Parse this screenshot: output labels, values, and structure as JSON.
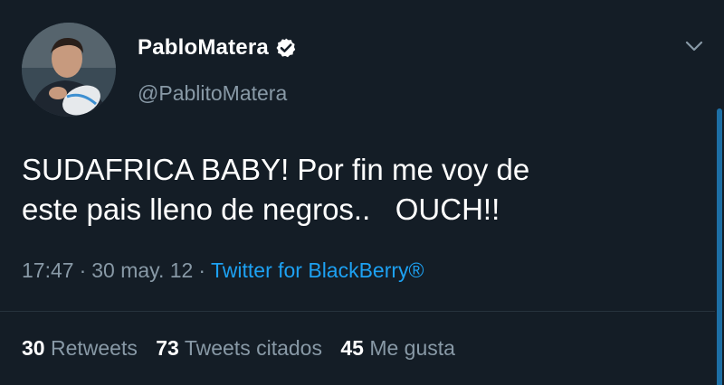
{
  "tweet": {
    "display_name": "PabloMatera",
    "handle": "@PablitoMatera",
    "verified_icon": "verified-badge-icon",
    "menu_icon": "chevron-down-icon",
    "text_lines": [
      "SUDAFRICA BABY! Por fin me voy de",
      "este pais lleno de negros..   OUCH!!"
    ],
    "time": "17:47",
    "date": "30 may. 12",
    "separator": "·",
    "source": "Twitter for BlackBerry®",
    "stats": {
      "retweets_count": "30",
      "retweets_label": "Retweets",
      "quotes_count": "73",
      "quotes_label": "Tweets citados",
      "likes_count": "45",
      "likes_label": "Me gusta"
    }
  },
  "colors": {
    "background": "#141d26",
    "secondary_text": "#8899a6",
    "link": "#1da1f2",
    "primary_text": "#ffffff"
  }
}
